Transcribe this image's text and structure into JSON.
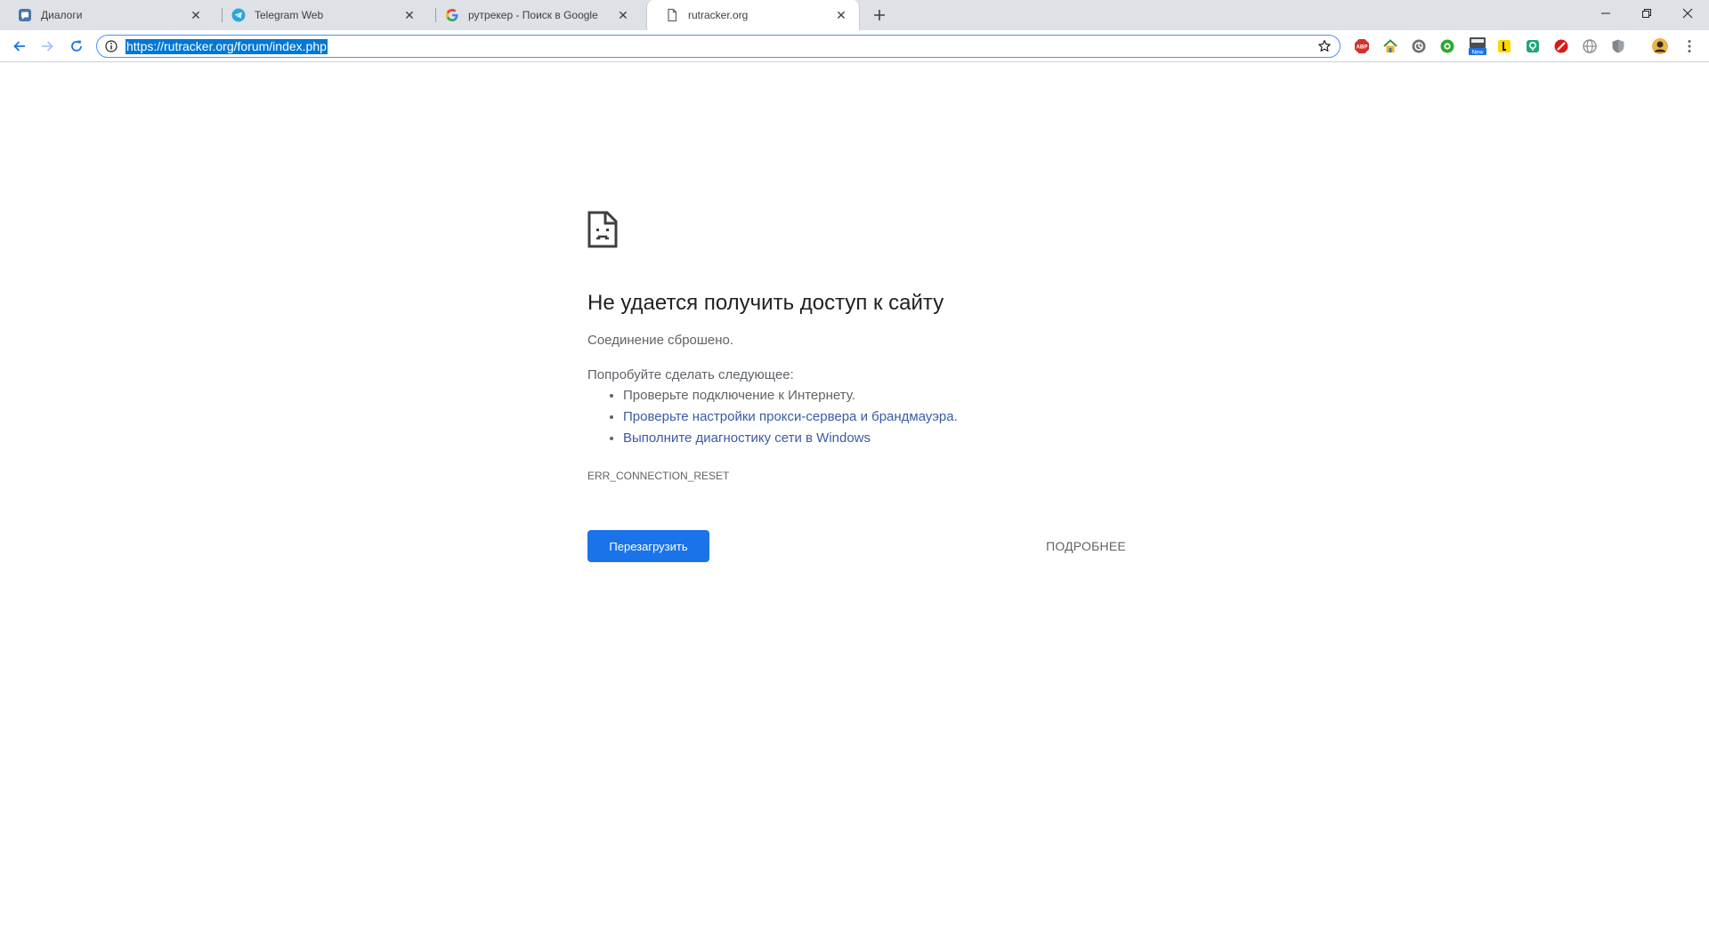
{
  "browser": {
    "tabs": [
      {
        "title": "Диалоги",
        "favicon": "vk-chat-icon",
        "active": false
      },
      {
        "title": "Telegram Web",
        "favicon": "telegram-icon",
        "active": false
      },
      {
        "title": "рутрекер - Поиск в Google",
        "favicon": "google-icon",
        "active": false
      },
      {
        "title": "rutracker.org",
        "favicon": "page-icon",
        "active": true
      }
    ],
    "omnibox": {
      "url": "https://rutracker.org/forum/index.php"
    },
    "extensions": [
      {
        "name": "adblock-plus-icon",
        "label": "ABP"
      },
      {
        "name": "home-extension-icon"
      },
      {
        "name": "circle-gray-extension-icon"
      },
      {
        "name": "circle-green-extension-icon"
      },
      {
        "name": "new-badge-extension-icon",
        "label": "New"
      },
      {
        "name": "yellow-extension-icon"
      },
      {
        "name": "teal-extension-icon"
      },
      {
        "name": "red-stop-extension-icon"
      },
      {
        "name": "globe-extension-icon"
      },
      {
        "name": "shield-extension-icon"
      },
      {
        "name": "profile-avatar-icon"
      },
      {
        "name": "menu-kebab-icon"
      }
    ],
    "colors": {
      "accent": "#1a73e8",
      "link": "#3b5ba5",
      "tabstrip": "#dee1e6",
      "selection": "#0078d7"
    }
  },
  "error_page": {
    "title": "Не удается получить доступ к сайту",
    "subtitle": "Соединение сброшено.",
    "suggestions_heading": "Попробуйте сделать следующее:",
    "suggestions": [
      {
        "text": "Проверьте подключение к Интернету.",
        "link": false
      },
      {
        "text": "Проверьте настройки прокси-сервера и брандмауэра.",
        "link": true
      },
      {
        "text": "Выполните диагностику сети в Windows",
        "link": true
      }
    ],
    "error_code": "ERR_CONNECTION_RESET",
    "reload_button": "Перезагрузить",
    "details_button": "ПОДРОБНЕЕ"
  }
}
